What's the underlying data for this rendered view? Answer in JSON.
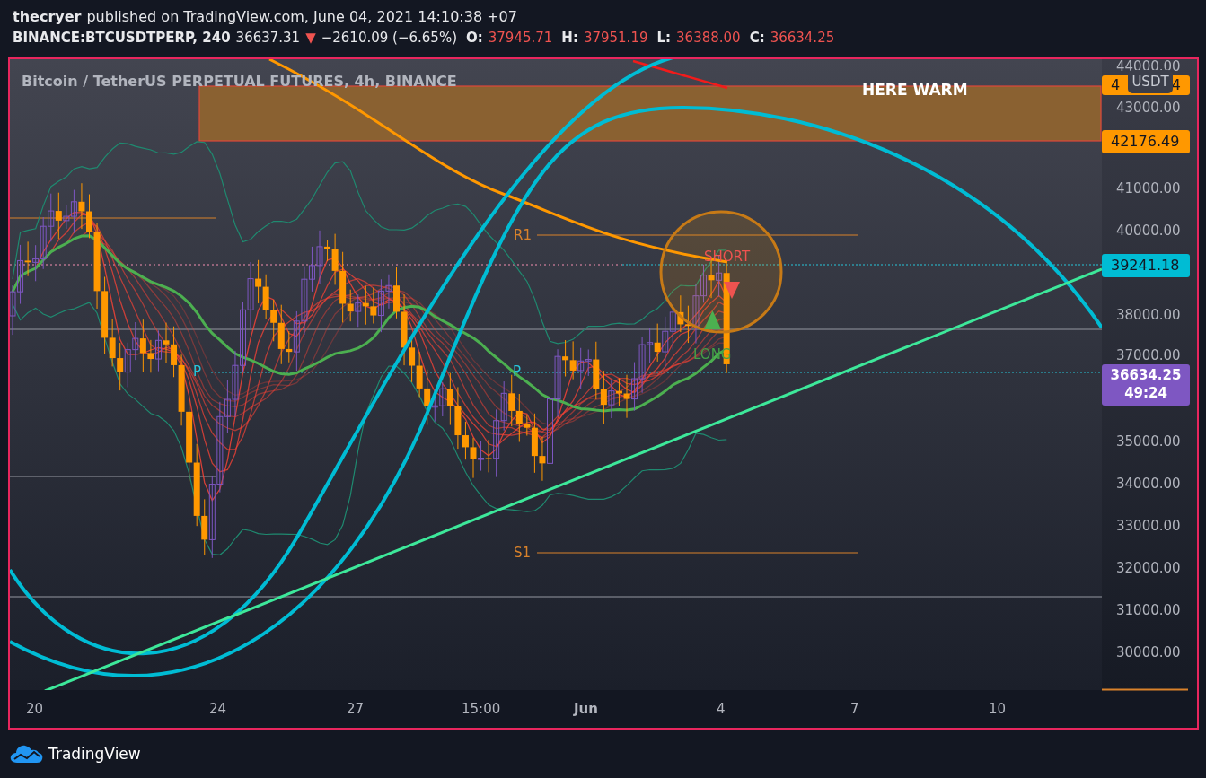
{
  "header": {
    "author": "thecryer",
    "published": "published on TradingView.com, June 04, 2021 14:10:38 +07"
  },
  "symbol": {
    "name": "BINANCE:BTCUSDTPERP, 240",
    "last": "36637.31",
    "change_arrow": "▼",
    "change": "−2610.09 (−6.65%)",
    "ohlc": [
      {
        "label": "O:",
        "value": "37945.71"
      },
      {
        "label": "H:",
        "value": "37951.19"
      },
      {
        "label": "L:",
        "value": "36388.00"
      },
      {
        "label": "C:",
        "value": "36634.25"
      }
    ]
  },
  "chart": {
    "title": "Bitcoin / TetherUS PERPETUAL FUTURES, 4h, BINANCE",
    "annotations": [
      {
        "kind": "zone",
        "text": "HERE WARM",
        "color": "#ffffff"
      },
      {
        "kind": "pivot",
        "text": "R1",
        "color": "#d9822b"
      },
      {
        "kind": "pivot",
        "text": "P",
        "color": "#26c6da"
      },
      {
        "kind": "pivot",
        "text": "P",
        "color": "#26c6da"
      },
      {
        "kind": "pivot",
        "text": "S1",
        "color": "#d9822b"
      },
      {
        "kind": "signal",
        "text": "SHORT",
        "color": "#ef5350"
      },
      {
        "kind": "signal",
        "text": "LONG",
        "color": "#43a047"
      }
    ],
    "price_ticks": [
      "44000.00",
      "43000.00",
      "41000.00",
      "40000.00",
      "38000.00",
      "37000.00",
      "35000.00",
      "34000.00",
      "33000.00",
      "32000.00",
      "31000.00",
      "30000.00"
    ],
    "price_tags": [
      {
        "segments": [
          "4",
          "4"
        ],
        "color": "#ff9800"
      },
      {
        "segments": [
          "42176.49"
        ],
        "color": "#ff9800"
      },
      {
        "segments": [
          "39241.18"
        ],
        "color": "#00bcd4"
      },
      {
        "segments": [
          "36634.25",
          "49:24"
        ],
        "color": "#7e57c2"
      }
    ],
    "currency_badge": "USDT",
    "time_ticks": [
      {
        "text": "20",
        "major": false
      },
      {
        "text": "24",
        "major": false
      },
      {
        "text": "27",
        "major": false
      },
      {
        "text": "15:00",
        "major": false
      },
      {
        "text": "Jun",
        "major": true
      },
      {
        "text": "4",
        "major": false
      },
      {
        "text": "7",
        "major": false
      },
      {
        "text": "10",
        "major": false
      }
    ]
  },
  "footer": {
    "brand": "TradingView"
  }
}
